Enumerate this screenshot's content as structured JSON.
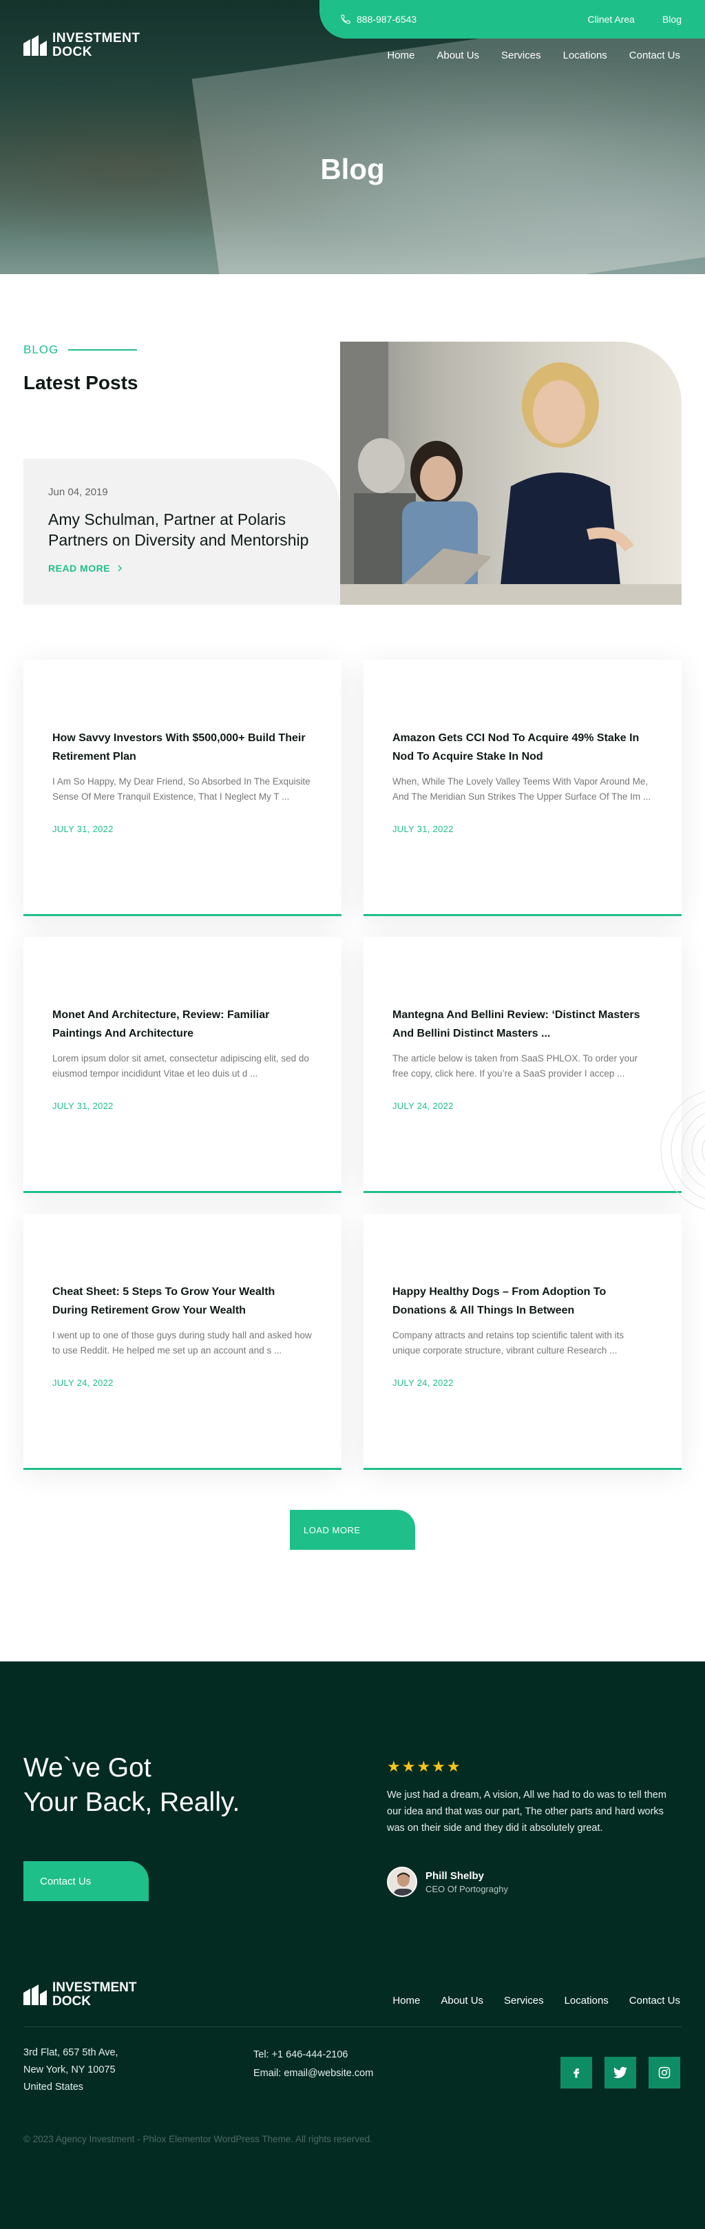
{
  "header": {
    "phone": "888-987-6543",
    "top_links": [
      "Clinet Area",
      "Blog"
    ],
    "logo_line1": "INVESTMENT",
    "logo_line2": "DOCK",
    "nav": [
      "Home",
      "About Us",
      "Services",
      "Locations",
      "Contact Us"
    ],
    "page_title": "Blog"
  },
  "latest": {
    "tag": "BLOG",
    "title": "Latest Posts",
    "featured": {
      "date": "Jun 04, 2019",
      "title": "Amy Schulman, Partner at Polaris Partners on Diversity and Mentorship",
      "more": "READ MORE"
    }
  },
  "posts": [
    {
      "title": "How Savvy Investors With $500,000+ Build Their Retirement Plan",
      "excerpt": "I Am So Happy, My Dear Friend, So Absorbed In The Exquisite Sense Of Mere Tranquil Existence, That I Neglect My T ...",
      "date": "JULY 31, 2022"
    },
    {
      "title": "Amazon Gets CCI Nod To Acquire 49% Stake In Nod To Acquire Stake In Nod",
      "excerpt": "When, While The Lovely Valley Teems With Vapor Around Me, And The Meridian Sun Strikes The Upper Surface Of The Im ...",
      "date": "JULY 31, 2022"
    },
    {
      "title": "Monet And Architecture, Review: Familiar Paintings And Architecture",
      "excerpt": "Lorem ipsum dolor sit amet, consectetur adipiscing elit, sed do eiusmod tempor incididunt  Vitae et leo duis ut d ...",
      "date": "JULY 31, 2022"
    },
    {
      "title": "Mantegna And Bellini Review: ‘Distinct Masters And Bellini Distinct Masters ...",
      "excerpt": "The article below is taken from SaaS PHLOX. To order your free copy, click here. If you’re a SaaS provider I accep ...",
      "date": "JULY 24, 2022"
    },
    {
      "title": "Cheat Sheet: 5 Steps To Grow Your Wealth During Retirement Grow Your Wealth",
      "excerpt": "I went up to one of those guys during study hall and asked how to use Reddit. He helped me set up an account and s ...",
      "date": "JULY 24, 2022"
    },
    {
      "title": "Happy Healthy Dogs – From Adoption To Donations & All Things In Between",
      "excerpt": "Company attracts and retains top scientific talent with its unique corporate structure, vibrant culture Research ...",
      "date": "JULY 24, 2022"
    }
  ],
  "load_more": "LOAD MORE",
  "footer": {
    "cta_line1": "We`ve Got",
    "cta_line2": "Your Back, Really.",
    "cta_button": "Contact Us",
    "stars": "★★★★★",
    "review": "We just had a dream, A vision, All we had to do was to tell them our idea and that was our part, The other parts and hard works was on their side and they did it absolutely great.",
    "reviewer_name": "Phill Shelby",
    "reviewer_role": "CEO Of Portograghy",
    "logo_line1": "INVESTMENT",
    "logo_line2": "DOCK",
    "nav": [
      "Home",
      "About Us",
      "Services",
      "Locations",
      "Contact Us"
    ],
    "address_line1": "3rd Flat, 657 5th Ave,",
    "address_line2": "New York, NY 10075",
    "address_line3": "United States",
    "tel": "Tel: +1 646-444-2106",
    "email": "Email: email@website.com",
    "copyright": "© 2023 Agency Investment - Phlox Elementor WordPress Theme. All rights reserved."
  },
  "colors": {
    "accent": "#1fbf8a",
    "footer_bg": "#042b22",
    "social_bg": "#0e8c63"
  },
  "icons": [
    "phone-icon",
    "logo-icon",
    "arrow-right-icon",
    "star-icon",
    "facebook-icon",
    "twitter-icon",
    "instagram-icon"
  ]
}
